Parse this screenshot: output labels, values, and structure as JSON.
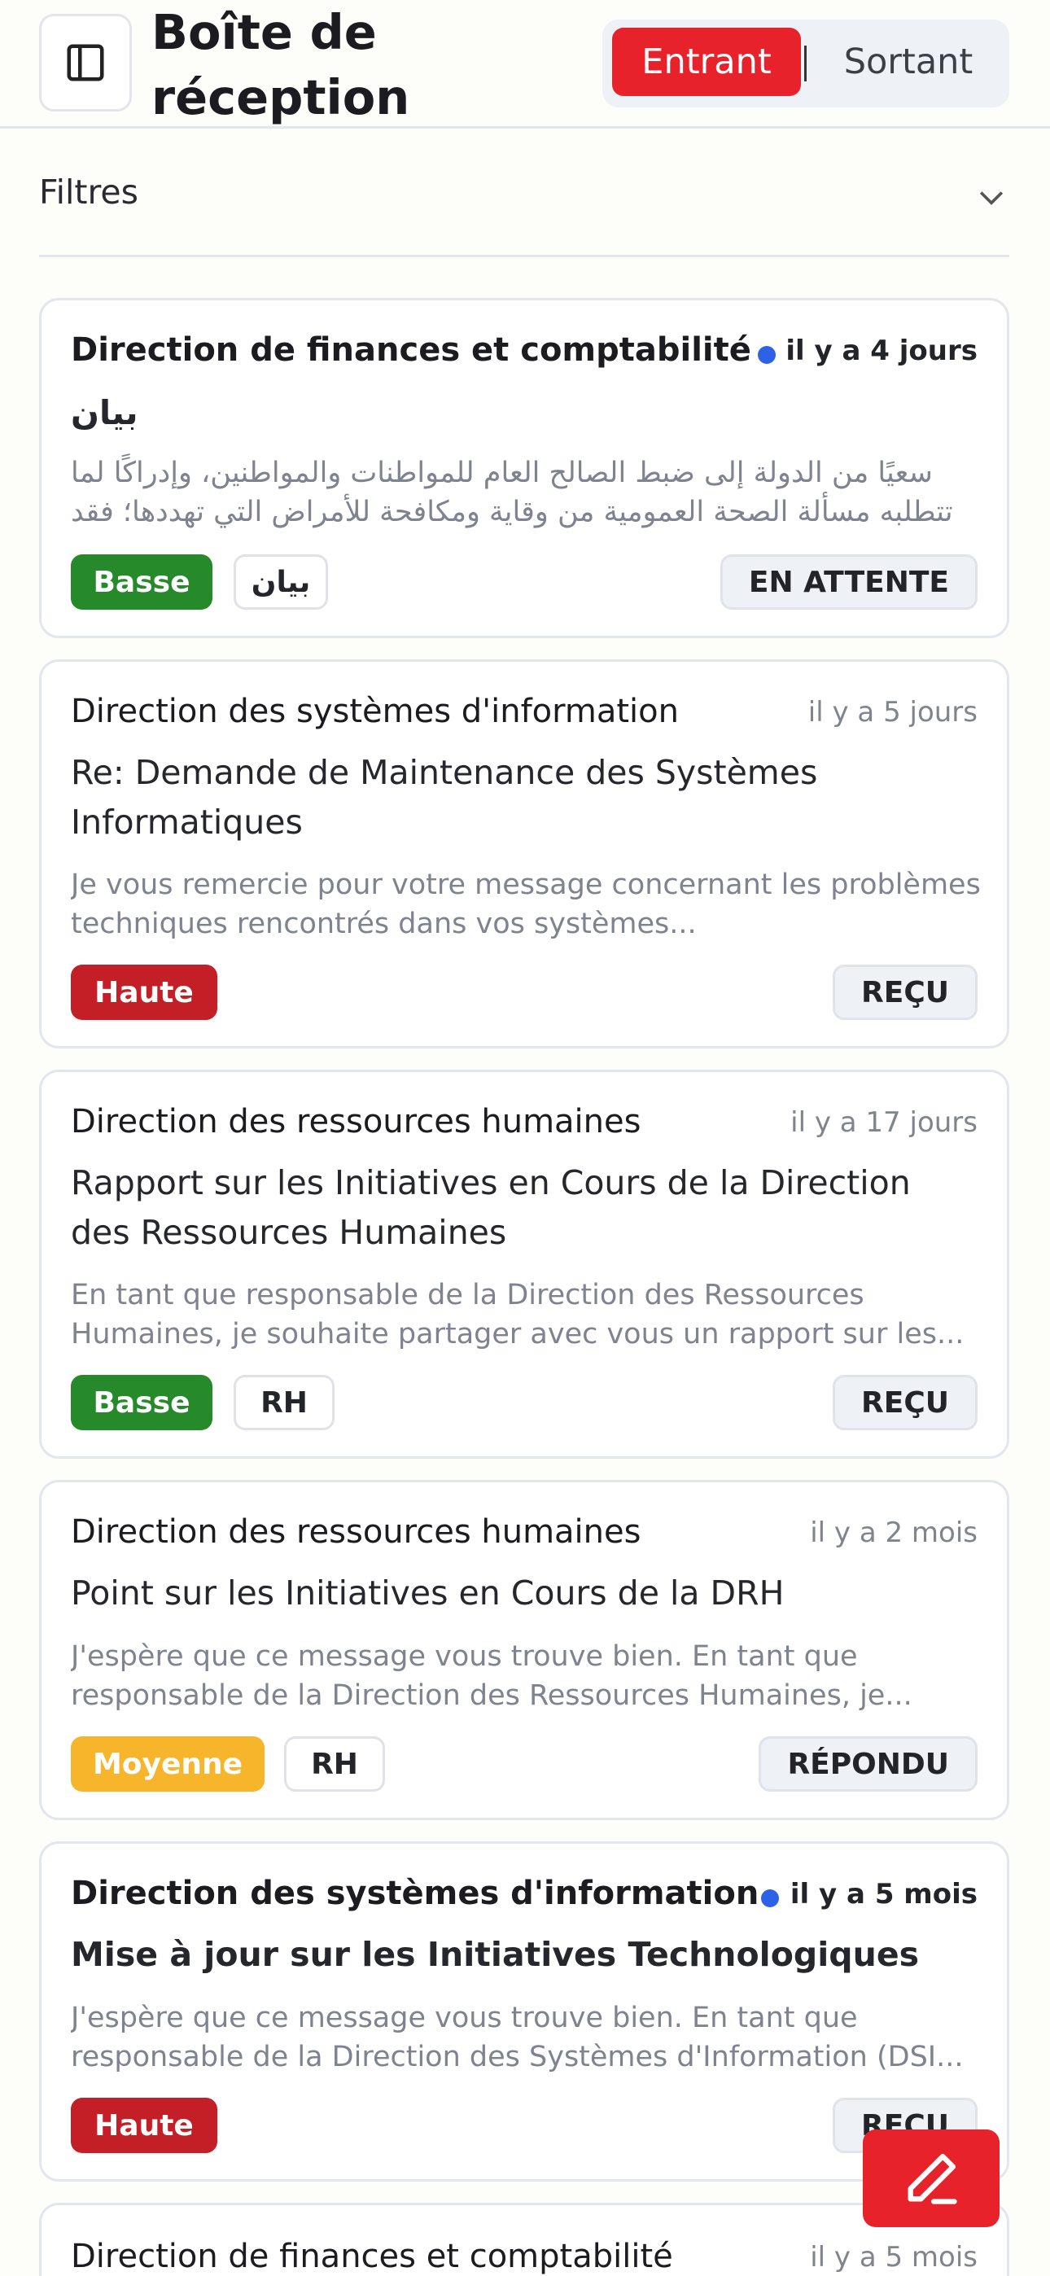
{
  "header": {
    "title": "Boîte de réception",
    "segment": {
      "incoming": "Entrant",
      "outgoing": "Sortant",
      "active": "incoming"
    },
    "sidebar_icon": "sidebar-icon"
  },
  "filters": {
    "label": "Filtres",
    "icon": "chevron-down-icon"
  },
  "messages": [
    {
      "sender": "Direction de finances et comptabilité",
      "time": "il y a 4 jours",
      "unread": true,
      "subject": "بيان",
      "preview": "سعيًا من الدولة إلى ضبط الصالح العام للمواطنات والمواطنين، وإدراكًا لما تتطلبه مسألة الصحة العمومية من وقاية ومكافحة للأمراض التي تهددها؛ فقد أمر السيد عبد المجيد...",
      "priority": "Basse",
      "tag": "بيان",
      "status": "EN ATTENTE"
    },
    {
      "sender": "Direction des systèmes d'information",
      "time": "il y a 5 jours",
      "unread": false,
      "subject": "Re: Demande de Maintenance des Systèmes Informatiques",
      "preview": "Je vous remercie pour votre message concernant les problèmes techniques rencontrés dans vos systèmes...",
      "priority": "Haute",
      "tag": "",
      "status": "REÇU"
    },
    {
      "sender": "Direction des ressources humaines",
      "time": "il y a 17 jours",
      "unread": false,
      "subject": "Rapport sur les Initiatives en Cours de la Direction des Ressources Humaines",
      "preview": "En tant que responsable de la Direction des Ressources Humaines, je souhaite partager avec vous un rapport sur les...",
      "priority": "Basse",
      "tag": "RH",
      "status": "REÇU"
    },
    {
      "sender": "Direction des ressources humaines",
      "time": "il y a 2 mois",
      "unread": false,
      "subject": "Point sur les Initiatives en Cours de la DRH",
      "preview": "J'espère que ce message vous trouve bien. En tant que responsable de la Direction des Ressources Humaines, je...",
      "priority": "Moyenne",
      "tag": "RH",
      "status": "RÉPONDU"
    },
    {
      "sender": "Direction des systèmes d'information",
      "time": "il y a 5 mois",
      "unread": true,
      "subject": "Mise à jour sur les Initiatives Technologiques",
      "preview": "J'espère que ce message vous trouve bien. En tant que responsable de la Direction des Systèmes d'Information (DSI...",
      "priority": "Haute",
      "tag": "",
      "status": "REÇU"
    },
    {
      "sender": "Direction de finances et comptabilité",
      "time": "il y a 5 mois",
      "unread": false
    }
  ],
  "fab": {
    "icon": "pen-icon"
  },
  "colors": {
    "accent": "#e8222a",
    "priority_low": "#278a2a",
    "priority_high": "#c41f27",
    "priority_medium": "#f6b52a",
    "unread_dot": "#2d62e8"
  }
}
